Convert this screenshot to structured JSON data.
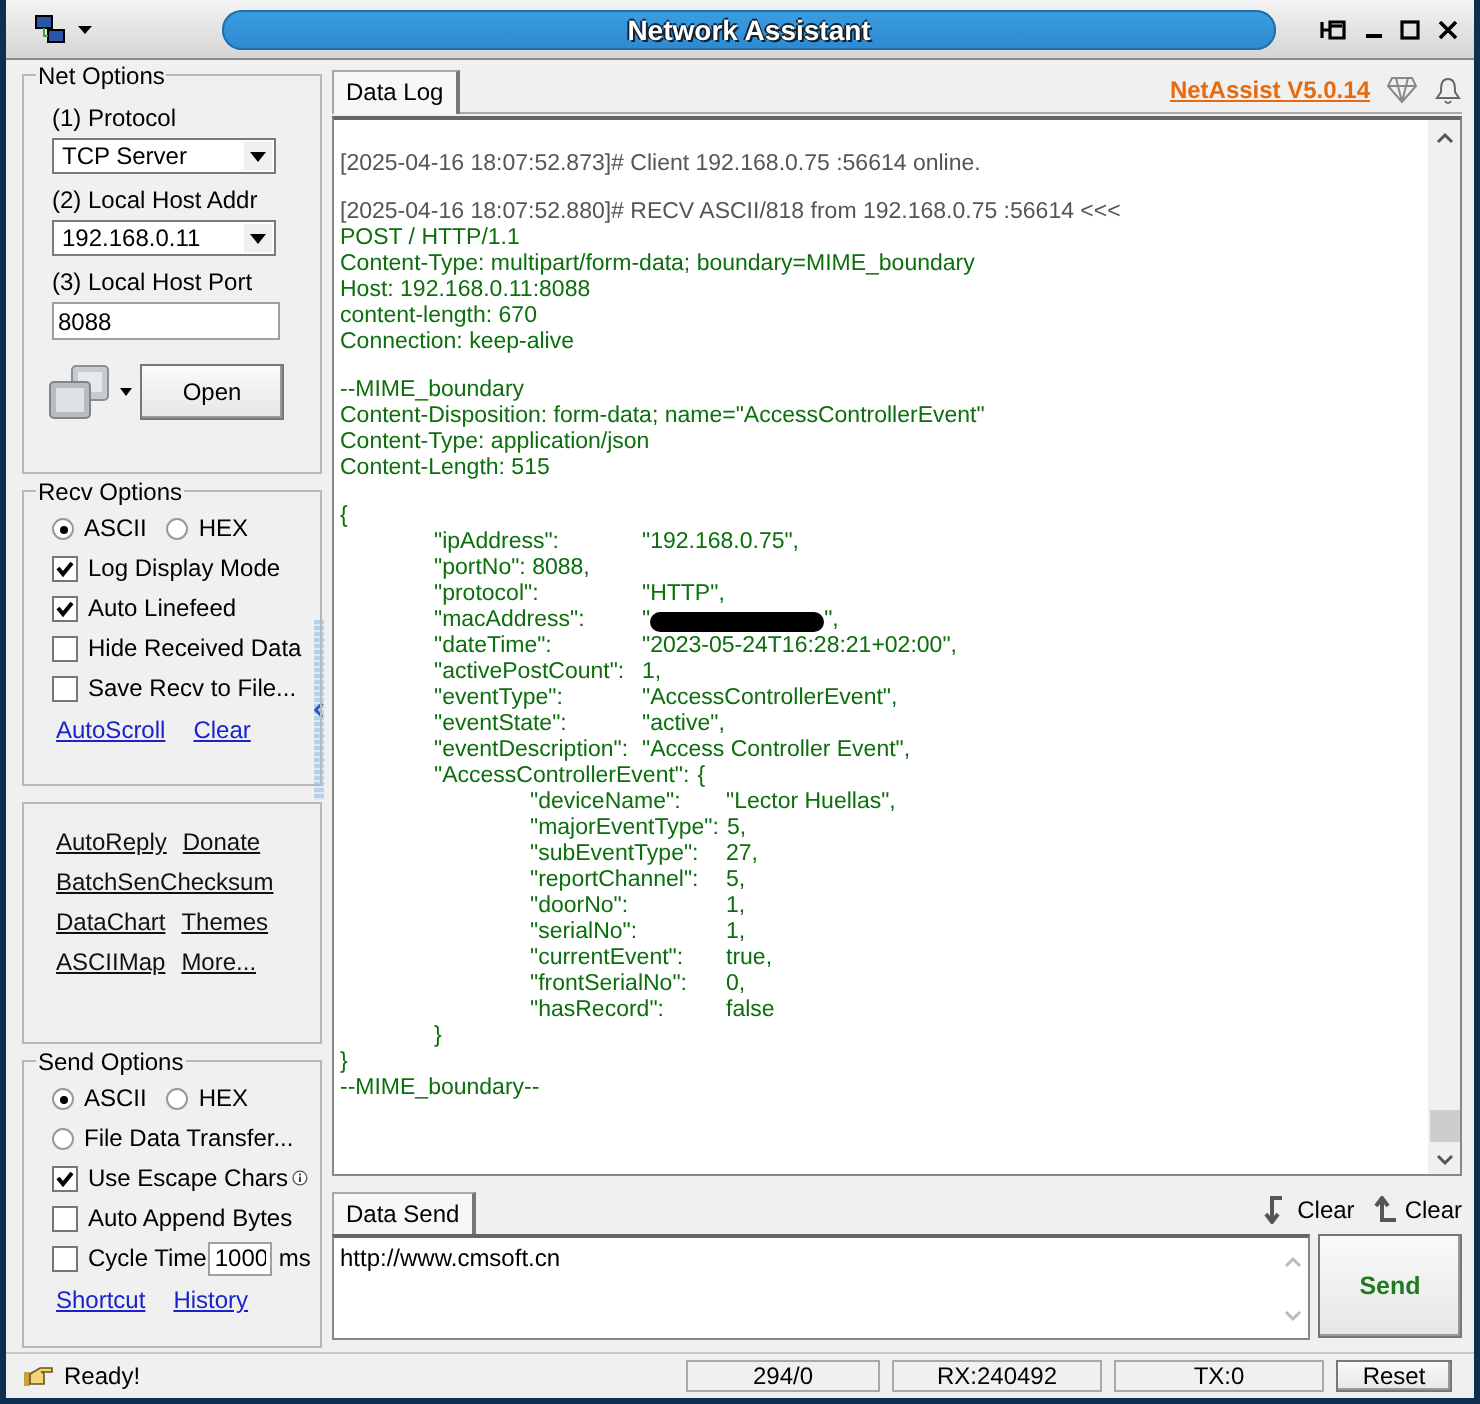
{
  "window": {
    "title": "Network Assistant"
  },
  "net_options": {
    "title": "Net Options",
    "protocol_label": "(1) Protocol",
    "protocol": "TCP Server",
    "addr_label": "(2) Local Host Addr",
    "addr": "192.168.0.11",
    "port_label": "(3) Local Host Port",
    "port": "8088",
    "open_button": "Open"
  },
  "recv_options": {
    "title": "Recv Options",
    "modes": [
      {
        "label": "ASCII",
        "selected": true
      },
      {
        "label": "HEX",
        "selected": false
      }
    ],
    "checks": [
      {
        "label": "Log Display Mode",
        "checked": true
      },
      {
        "label": "Auto Linefeed",
        "checked": true
      },
      {
        "label": "Hide Received Data",
        "checked": false
      },
      {
        "label": "Save Recv to File...",
        "checked": false
      }
    ],
    "links": [
      "AutoScroll",
      "Clear"
    ]
  },
  "tools": [
    [
      "AutoReply",
      "Donate"
    ],
    [
      "BatchSenChecksum"
    ],
    [
      "DataChart",
      "Themes"
    ],
    [
      "ASCIIMap",
      "More..."
    ]
  ],
  "send_options": {
    "title": "Send Options",
    "modes": [
      {
        "label": "ASCII",
        "selected": true
      },
      {
        "label": "HEX",
        "selected": false
      }
    ],
    "file_transfer": {
      "label": "File Data Transfer...",
      "selected": false
    },
    "checks": [
      {
        "label": "Use Escape Chars",
        "checked": true,
        "info": true
      },
      {
        "label": "Auto Append Bytes",
        "checked": false,
        "info": false
      }
    ],
    "cycle": {
      "label": "Cycle Time",
      "checked": false,
      "value": "1000",
      "unit": "ms"
    },
    "links": [
      "Shortcut",
      "History"
    ]
  },
  "log_tab": {
    "label": "Data Log",
    "selected": true
  },
  "brand_link": "NetAssist V5.0.14",
  "log": [
    [
      {
        "kind": "status",
        "text": "[2025-04-16 18:07:52.873]# Client 192.168.0.75 :56614 online."
      }
    ],
    [
      {
        "kind": "status",
        "text": "[2025-04-16 18:07:52.880]# RECV ASCII/818 from 192.168.0.75 :56614 <<<"
      },
      {
        "kind": "data",
        "text": "POST / HTTP/1.1"
      },
      {
        "kind": "data",
        "text": "Content-Type: multipart/form-data; boundary=MIME_boundary"
      },
      {
        "kind": "data",
        "text": "Host: 192.168.0.11:8088"
      },
      {
        "kind": "data",
        "text": "content-length: 670"
      },
      {
        "kind": "data",
        "text": "Connection: keep-alive"
      }
    ],
    [
      {
        "kind": "data",
        "text": "--MIME_boundary"
      },
      {
        "kind": "data",
        "text": "Content-Disposition: form-data; name=\"AccessControllerEvent\""
      },
      {
        "kind": "data",
        "text": "Content-Type: application/json"
      },
      {
        "kind": "data",
        "text": "Content-Length: 515"
      }
    ],
    [
      {
        "kind": "object",
        "open": "{",
        "close": "}",
        "fields": [
          {
            "key": "\"ipAddress\":",
            "value": "\"192.168.0.75\","
          },
          {
            "key": "\"portNo\": 8088,"
          },
          {
            "key": "\"protocol\":",
            "value": "\"HTTP\","
          },
          {
            "key": "\"macAddress\":",
            "value": "\"",
            "redacted": true,
            "value_after": "\","
          },
          {
            "key": "\"dateTime\":",
            "value": "\"2023-05-24T16:28:21+02:00\","
          },
          {
            "key": "\"activePostCount\":",
            "value": "1,"
          },
          {
            "key": "\"eventType\":",
            "value": "\"AccessControllerEvent\","
          },
          {
            "key": "\"eventState\":",
            "value": "\"active\","
          },
          {
            "key": "\"eventDescription\":",
            "value": "\"Access Controller Event\","
          },
          {
            "key": "\"AccessControllerEvent\":",
            "value": "{",
            "close": "}",
            "children": [
              {
                "key": "\"deviceName\":",
                "value": "\"Lector Huellas\","
              },
              {
                "key": "\"majorEventType\":",
                "value": "5,"
              },
              {
                "key": "\"subEventType\":",
                "value": "27,"
              },
              {
                "key": "\"reportChannel\":",
                "value": "5,"
              },
              {
                "key": "\"doorNo\":",
                "value": "1,"
              },
              {
                "key": "\"serialNo\":",
                "value": "1,"
              },
              {
                "key": "\"currentEvent\":",
                "value": "true,"
              },
              {
                "key": "\"frontSerialNo\":",
                "value": "0,"
              },
              {
                "key": "\"hasRecord\":",
                "value": "false"
              }
            ]
          }
        ]
      },
      {
        "kind": "data",
        "text": "--MIME_boundary--"
      }
    ]
  ],
  "send_tab": {
    "label": "Data Send",
    "selected": true
  },
  "send_clear_buttons": [
    "Clear",
    "Clear"
  ],
  "send_text": "http://www.cmsoft.cn",
  "send_button": "Send",
  "status_bar": {
    "message": "Ready!",
    "count": "294/0",
    "rx": "RX:240492",
    "tx": "TX:0",
    "reset": "Reset"
  }
}
